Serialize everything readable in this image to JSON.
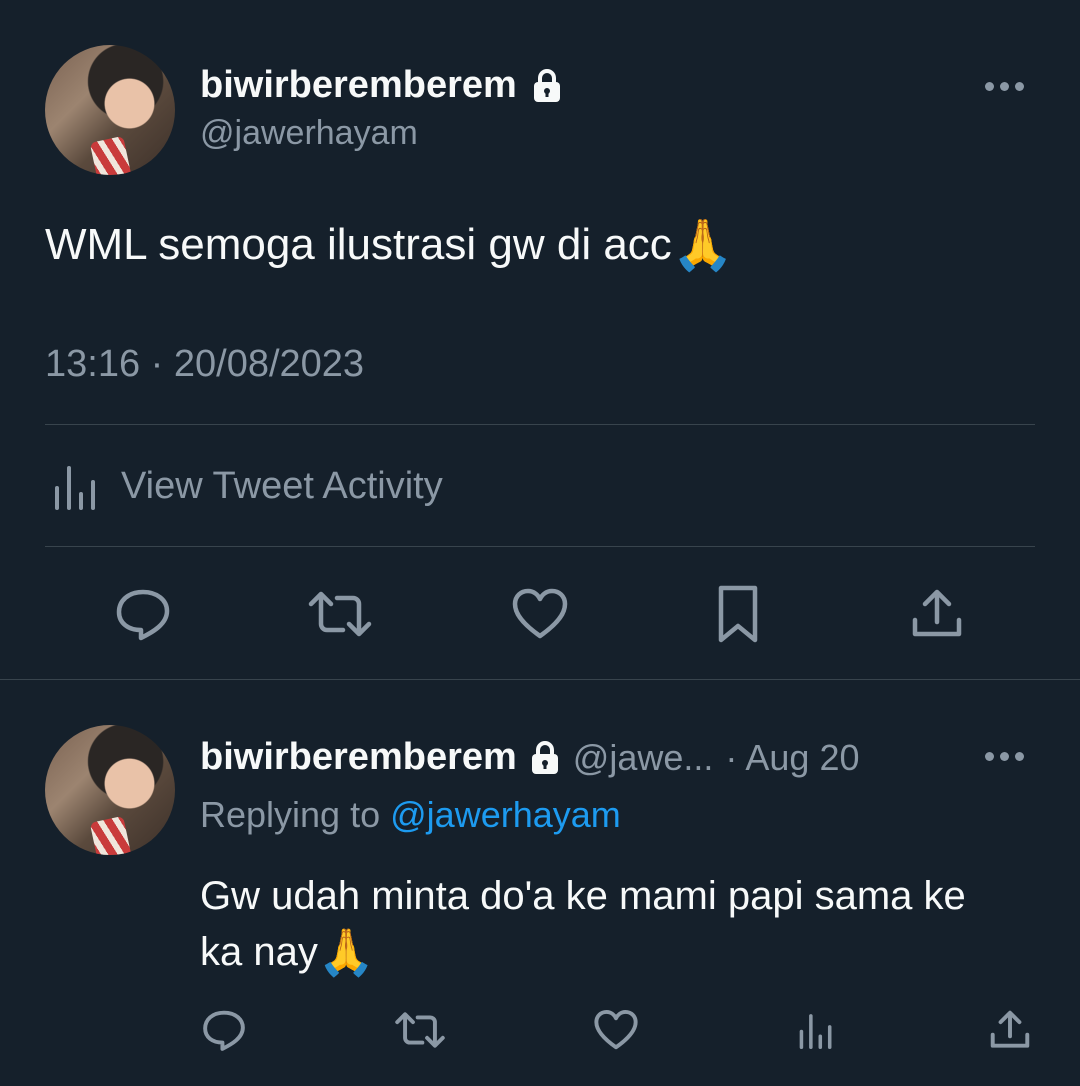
{
  "main_tweet": {
    "display_name": "biwirberemberem",
    "handle": "@jawerhayam",
    "text": "WML semoga ilustrasi gw di acc",
    "emoji": "🙏",
    "timestamp": "13:16 · 20/08/2023",
    "activity_label": "View Tweet Activity"
  },
  "reply": {
    "display_name": "biwirberemberem",
    "handle_truncated": "@jawe...",
    "date": "· Aug 20",
    "replying_prefix": "Replying to",
    "replying_handle": "@jawerhayam",
    "text_line1": "Gw udah minta do'a ke mami papi sama ke",
    "text_line2": "ka nay",
    "emoji": "🙏"
  },
  "icons": {
    "lock": "lock-icon",
    "more": "more-options-icon",
    "reply": "reply-icon",
    "retweet": "retweet-icon",
    "like": "heart-icon",
    "bookmark": "bookmark-icon",
    "share": "share-icon",
    "analytics": "analytics-icon"
  },
  "colors": {
    "background": "#15202b",
    "text": "#f7f9f9",
    "muted": "#8b98a5",
    "link": "#1d9bf0",
    "divider": "#38444d"
  }
}
